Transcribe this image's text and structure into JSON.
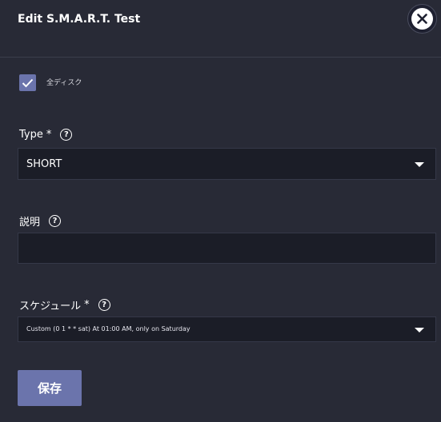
{
  "dialog": {
    "title": "Edit S.M.A.R.T. Test",
    "close_icon": "close-icon"
  },
  "all_disks": {
    "label": "全ディスク",
    "checked": true
  },
  "type_field": {
    "label": "Type",
    "required_mark": "*",
    "value": "SHORT"
  },
  "description_field": {
    "label": "説明",
    "value": ""
  },
  "schedule_field": {
    "label": "スケジュール",
    "required_mark": "*",
    "value": "Custom (0 1 * * sat) At 01:00 AM, only on Saturday"
  },
  "actions": {
    "save_label": "保存"
  },
  "colors": {
    "background": "#282a36",
    "input_background": "#1b1d27",
    "accent": "#6b74ac"
  }
}
